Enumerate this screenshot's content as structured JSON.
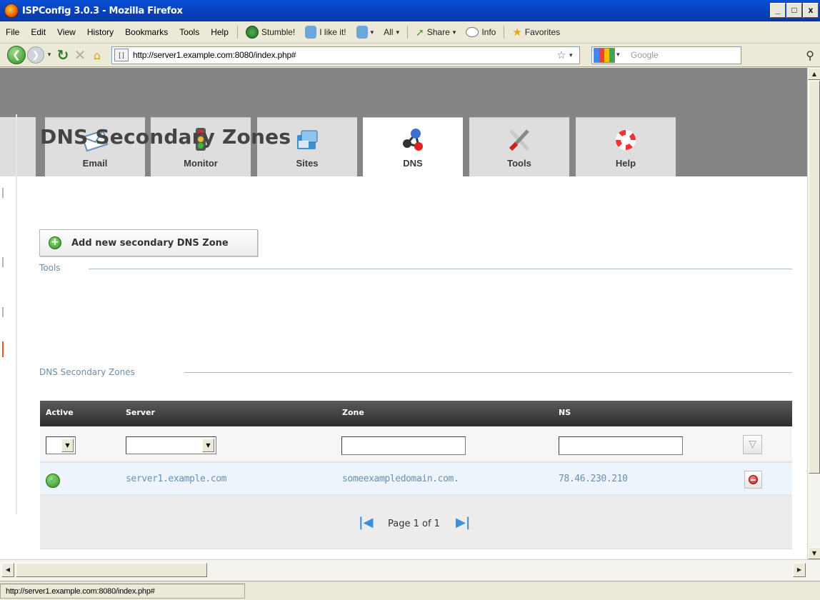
{
  "window": {
    "title": "ISPConfig 3.0.3 - Mozilla Firefox",
    "controls": [
      "_",
      "□",
      "x"
    ]
  },
  "menubar": {
    "items": [
      "File",
      "Edit",
      "View",
      "History",
      "Bookmarks",
      "Tools",
      "Help"
    ],
    "toolbar": {
      "stumble": "Stumble!",
      "like": "I like it!",
      "all": "All",
      "share": "Share",
      "info": "Info",
      "favorites": "Favorites"
    }
  },
  "navbar": {
    "url": "http://server1.example.com:8080/index.php#",
    "search_placeholder": "Google"
  },
  "tabs": [
    {
      "label": "Email",
      "icon": "email-icon",
      "active": false
    },
    {
      "label": "Monitor",
      "icon": "monitor-icon",
      "active": false
    },
    {
      "label": "Sites",
      "icon": "sites-icon",
      "active": false
    },
    {
      "label": "DNS",
      "icon": "dns-icon",
      "active": true
    },
    {
      "label": "Tools",
      "icon": "tools-icon",
      "active": false
    },
    {
      "label": "Help",
      "icon": "help-icon",
      "active": false
    }
  ],
  "page": {
    "title": "DNS Secondary Zones",
    "tools_legend": "Tools",
    "add_button": "Add new secondary DNS Zone",
    "list_legend": "DNS Secondary Zones"
  },
  "table": {
    "headers": {
      "active": "Active",
      "server": "Server",
      "zone": "Zone",
      "ns": "NS"
    },
    "rows": [
      {
        "active": true,
        "server": "server1.example.com",
        "zone": "someexampledomain.com.",
        "ns": "78.46.230.210"
      }
    ],
    "pager": "Page 1 of 1"
  },
  "statusbar": {
    "text": "http://server1.example.com:8080/index.php#"
  },
  "colors": {
    "accent": "#6c8daa",
    "link": "#6a8fb3",
    "header_bg": "#3a3a3a",
    "tab_strip": "#858585"
  }
}
